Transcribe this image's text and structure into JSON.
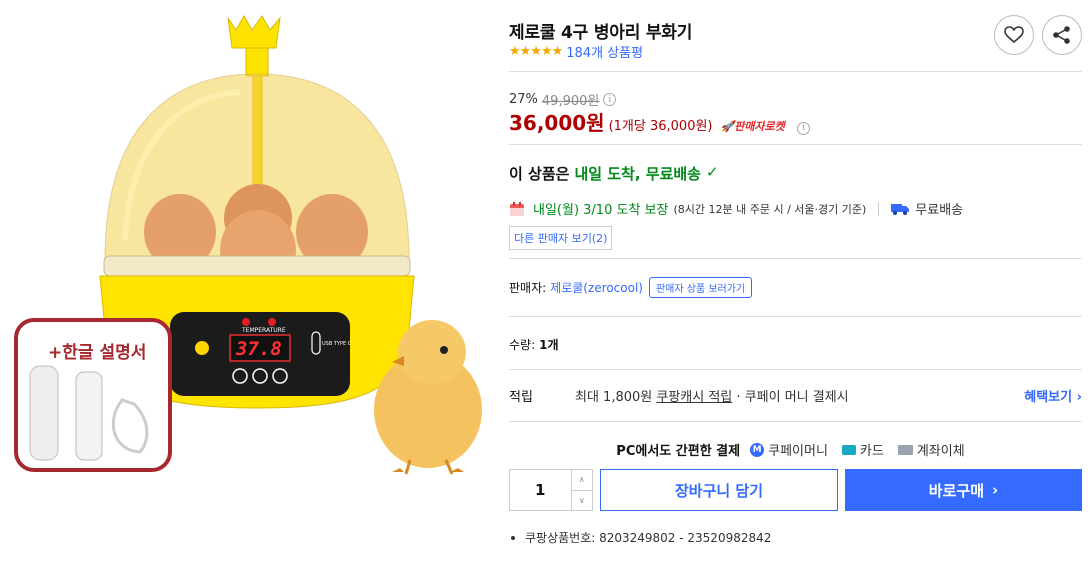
{
  "product": {
    "title": "제로쿨 4구 병아리 부화기",
    "stars": "★★★★★",
    "rating_value": 4.5,
    "review_count": "184개 상품평"
  },
  "image": {
    "badge_text": "+한글 설명서",
    "temp_display": "37.8",
    "temp_label": "TEMPERATURE",
    "usb_label": "USB TYPE C"
  },
  "price": {
    "discount_rate": "27%",
    "original": "49,900원",
    "sale": "36,000원",
    "unit": "(1개당 36,000원)",
    "rocket_badge": "🚀판매자로켓",
    "info_glyph": "i"
  },
  "delivery": {
    "headline_prefix": "이 상품은",
    "headline_highlight": "내일 도착, 무료배송",
    "check": "✓",
    "date": "내일(월) 3/10 도착 보장",
    "cutoff": "(8시간 12분  내 주문 시 / 서울·경기 기준)",
    "free_shipping": "무료배송",
    "other_sellers": "다른 판매자 보기(2)"
  },
  "seller": {
    "label": "판매자:",
    "name": "제로쿨(zerocool)",
    "tooltip": "판매자 상품 보러가기"
  },
  "quantity": {
    "label": "수량:",
    "value_text": "1개",
    "input_value": "1",
    "up": "∧",
    "down": "∨"
  },
  "points": {
    "title": "적립",
    "text_prefix": "최대 1,800원",
    "text_link": "쿠팡캐시 적립",
    "text_suffix": "· 쿠페이 머니 결제시",
    "benefit_link": "혜택보기 ›"
  },
  "payment": {
    "lead": "PC에서도 간편한 결제",
    "methods": [
      "쿠페이머니",
      "카드",
      "계좌이체"
    ],
    "coupay_glyph": "M"
  },
  "actions": {
    "cart": "장바구니 담기",
    "buy": "바로구매",
    "buy_arrow": "›"
  },
  "product_code": "쿠팡상품번호: 8203249802 - 23520982842",
  "colors": {
    "accent": "#346aff",
    "sale_price": "#ae0000",
    "delivery_green": "#00891a",
    "star": "#f5a700",
    "incubator_yellow": "#ffe400"
  }
}
